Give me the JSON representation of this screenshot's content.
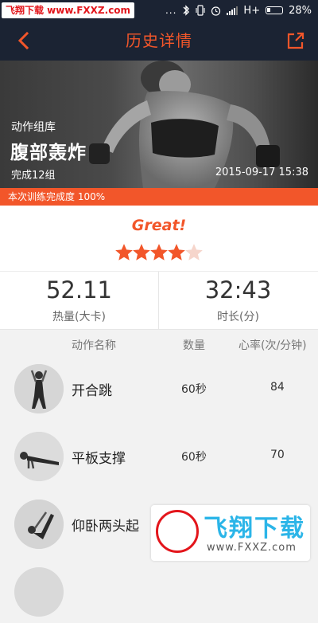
{
  "statusbar": {
    "watermark": "飞翔下载 www.FXXZ.com",
    "signal_dots": "...",
    "network": "H+",
    "battery": "28%"
  },
  "nav": {
    "title": "历史详情",
    "back_icon": "chevron-left-icon",
    "share_icon": "share-icon",
    "accent": "#f2562a",
    "background": "#1b2333"
  },
  "hero": {
    "category": "动作组库",
    "workout_name": "腹部轰炸",
    "sets": "完成12组",
    "datetime": "2015-09-17 15:38"
  },
  "progress": {
    "label": "本次训练完成度 100%",
    "value": 1.0
  },
  "rating": {
    "text": "Great!",
    "stars": 4,
    "max_stars": 5
  },
  "stats": {
    "calories": {
      "value": "52.11",
      "label": "热量(大卡)"
    },
    "duration": {
      "value": "32:43",
      "label": "时长(分)"
    }
  },
  "table": {
    "headers": {
      "name": "动作名称",
      "qty": "数量",
      "hr": "心率(次/分钟)"
    },
    "rows": [
      {
        "name": "开合跳",
        "qty": "60秒",
        "hr": "84"
      },
      {
        "name": "平板支撑",
        "qty": "60秒",
        "hr": "70"
      },
      {
        "name": "仰卧两头起",
        "qty": "",
        "hr": ""
      }
    ]
  },
  "footer_watermark": {
    "brand": "飞翔下载",
    "url": "www.FXXZ.com"
  }
}
